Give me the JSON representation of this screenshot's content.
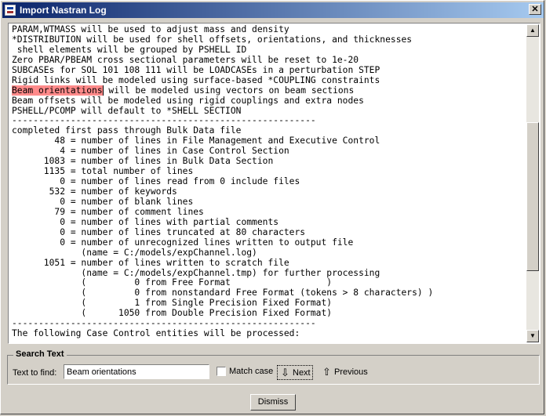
{
  "window": {
    "title": "Import Nastran Log",
    "close_glyph": "✕"
  },
  "log": {
    "lines": [
      "PARAM,WTMASS will be used to adjust mass and density",
      "*DISTRIBUTION will be used for shell offsets, orientations, and thicknesses",
      " shell elements will be grouped by PSHELL ID",
      "Zero PBAR/PBEAM cross sectional parameters will be reset to 1e-20",
      "SUBCASEs for SOL 101 108 111 will be LOADCASEs in a perturbation STEP",
      "Rigid links will be modeled using surface-based *COUPLING constraints",
      "Beam orientations will be modeled using vectors on beam sections",
      "Beam offsets will be modeled using rigid couplings and extra nodes",
      "PSHELL/PCOMP will default to *SHELL SECTION",
      "---------------------------------------------------------",
      "completed first pass through Bulk Data file",
      "        48 = number of lines in File Management and Executive Control",
      "         4 = number of lines in Case Control Section",
      "      1083 = number of lines in Bulk Data Section",
      "      1135 = total number of lines",
      "         0 = number of lines read from 0 include files",
      "       532 = number of keywords",
      "         0 = number of blank lines",
      "        79 = number of comment lines",
      "         0 = number of lines with partial comments",
      "         0 = number of lines truncated at 80 characters",
      "         0 = number of unrecognized lines written to output file",
      "             (name = C:/models/expChannel.log)",
      "      1051 = number of lines written to scratch file",
      "             (name = C:/models/expChannel.tmp) for further processing",
      "             (         0 from Free Format                  )",
      "             (         0 from nonstandard Free Format (tokens > 8 characters) )",
      "             (         1 from Single Precision Fixed Format)",
      "             (      1050 from Double Precision Fixed Format)",
      "---------------------------------------------------------",
      "The following Case Control entities will be processed:"
    ],
    "highlight": {
      "line_index": 6,
      "text": "Beam orientations",
      "color": "#ff8a8a"
    }
  },
  "search": {
    "group_title": "Search Text",
    "label": "Text to find:",
    "value": "Beam orientations",
    "match_case_label": "Match case",
    "match_case_checked": false,
    "next_label": "Next",
    "previous_label": "Previous"
  },
  "footer": {
    "dismiss_label": "Dismiss"
  },
  "icons": {
    "app": "app-icon",
    "next": "down-arrow-icon",
    "previous": "up-arrow-icon"
  },
  "colors": {
    "title_start": "#0a246a",
    "title_end": "#a6caf0",
    "face": "#d4d0c8"
  }
}
